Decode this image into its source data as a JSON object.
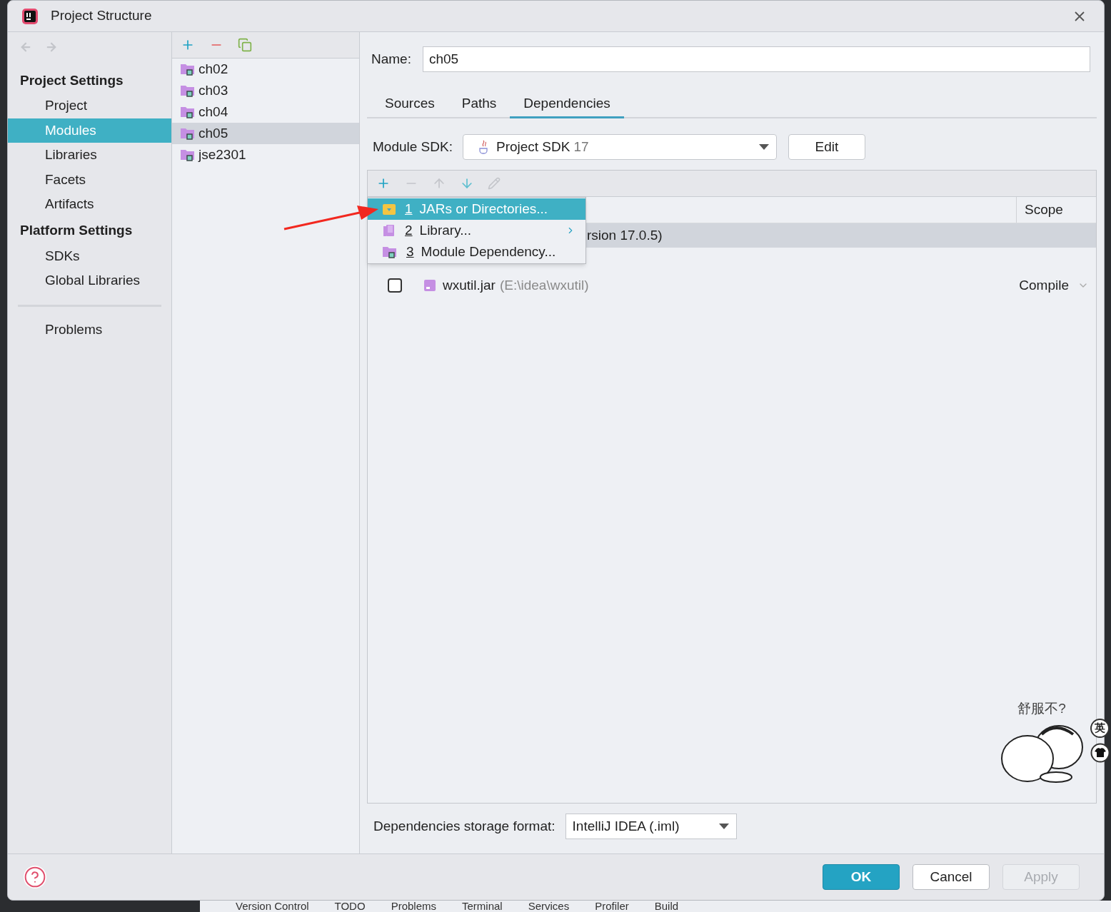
{
  "window": {
    "title": "Project Structure"
  },
  "sidebar": {
    "sections": [
      {
        "heading": "Project Settings",
        "items": [
          {
            "label": "Project",
            "selected": false
          },
          {
            "label": "Modules",
            "selected": true
          },
          {
            "label": "Libraries",
            "selected": false
          },
          {
            "label": "Facets",
            "selected": false
          },
          {
            "label": "Artifacts",
            "selected": false
          }
        ]
      },
      {
        "heading": "Platform Settings",
        "items": [
          {
            "label": "SDKs",
            "selected": false
          },
          {
            "label": "Global Libraries",
            "selected": false
          }
        ]
      }
    ],
    "bottom_items": [
      {
        "label": "Problems",
        "selected": false
      }
    ]
  },
  "modules": [
    {
      "label": "ch02",
      "selected": false
    },
    {
      "label": "ch03",
      "selected": false
    },
    {
      "label": "ch04",
      "selected": false
    },
    {
      "label": "ch05",
      "selected": true
    },
    {
      "label": "jse2301",
      "selected": false
    }
  ],
  "name_field": {
    "label": "Name:",
    "value": "ch05"
  },
  "tabs": [
    {
      "label": "Sources",
      "selected": false
    },
    {
      "label": "Paths",
      "selected": false
    },
    {
      "label": "Dependencies",
      "selected": true
    }
  ],
  "module_sdk": {
    "label": "Module SDK:",
    "value": "Project SDK",
    "version": "17",
    "edit_button": "Edit"
  },
  "dependencies": {
    "columns": [
      "Scope"
    ],
    "rows": [
      {
        "kind": "sdk",
        "name": "rsion 17.0.5)",
        "selected": true
      },
      {
        "kind": "library",
        "checked": false,
        "name": "wxutil.jar",
        "path": "(E:\\idea\\wxutil)",
        "scope": "Compile",
        "selected": false
      }
    ]
  },
  "add_menu": [
    {
      "mnemonic": "1",
      "label": "JARs or Directories...",
      "kind": "jar",
      "selected": true,
      "submenu": false
    },
    {
      "mnemonic": "2",
      "label": "Library...",
      "kind": "library",
      "selected": false,
      "submenu": true
    },
    {
      "mnemonic": "3",
      "label": "Module Dependency...",
      "kind": "module",
      "selected": false,
      "submenu": false
    }
  ],
  "storage_format": {
    "label": "Dependencies storage format:",
    "value": "IntelliJ IDEA (.iml)"
  },
  "buttons": [
    {
      "label": "OK",
      "kind": "primary",
      "disabled": false
    },
    {
      "label": "Cancel",
      "kind": "normal",
      "disabled": false
    },
    {
      "label": "Apply",
      "disabled": true
    }
  ],
  "sticker": {
    "caption": "舒服不?"
  },
  "ime": {
    "label": "英"
  },
  "tool_window_bar": [
    "Version Control",
    "TODO",
    "Problems",
    "Terminal",
    "Services",
    "Profiler",
    "Build"
  ]
}
